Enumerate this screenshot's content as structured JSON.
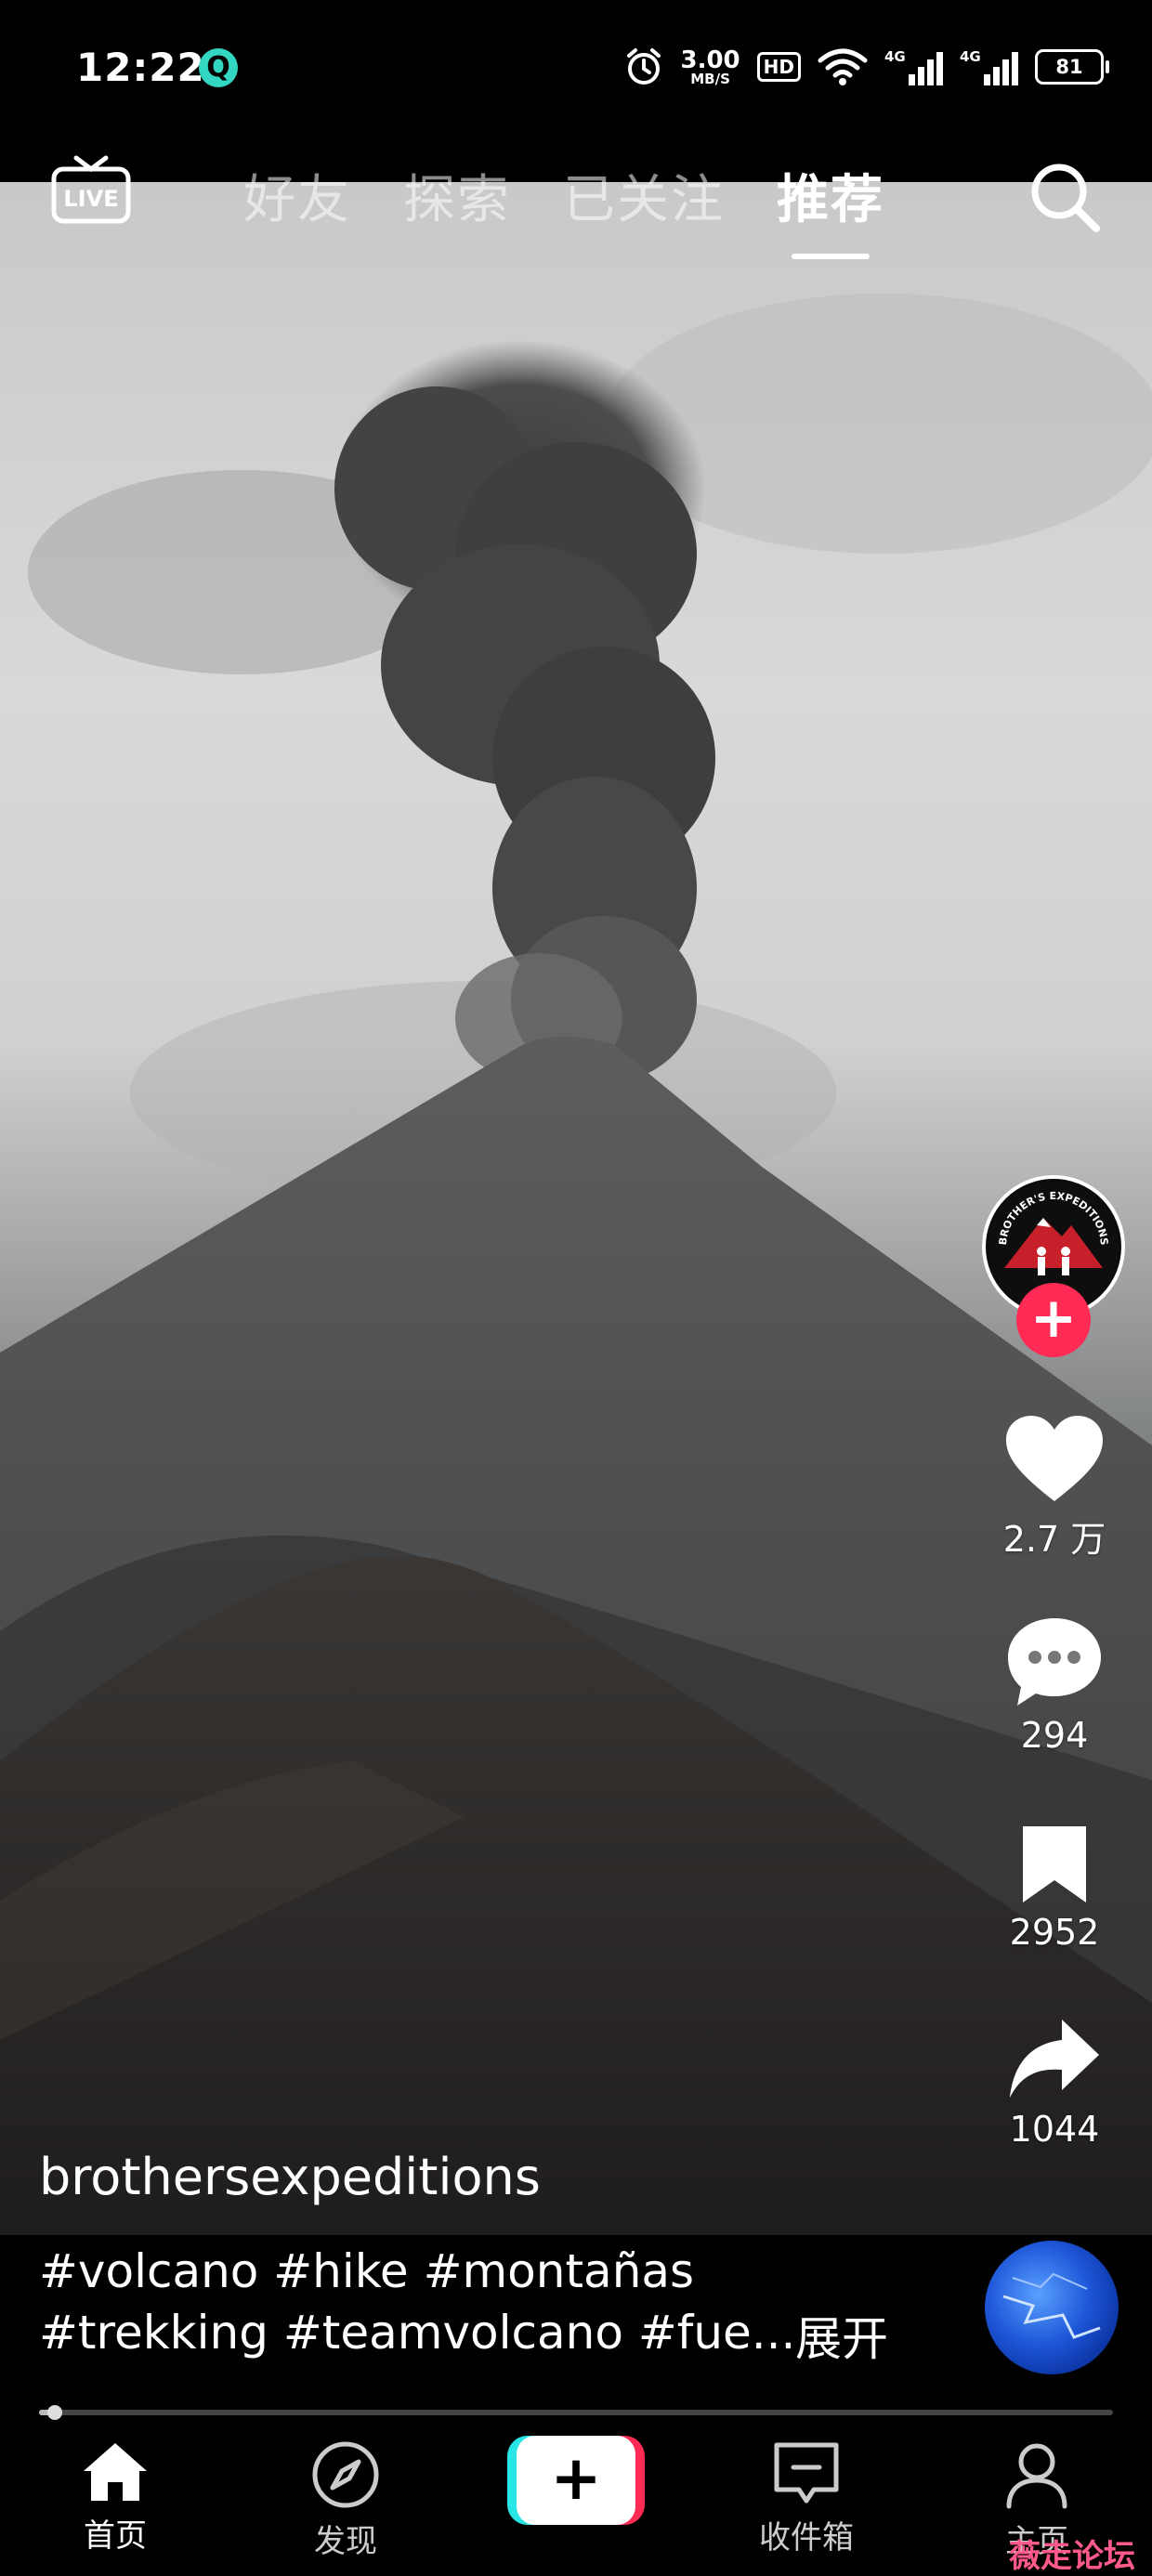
{
  "status_bar": {
    "time": "12:22",
    "app_icon_letter": "Q",
    "net_speed_value": "3.00",
    "net_speed_unit": "MB/S",
    "hd_label": "HD",
    "signal_1_label": "4G",
    "signal_2_label": "4G",
    "battery": "81"
  },
  "top_nav": {
    "live_label": "LIVE",
    "tabs": [
      {
        "label": "好友",
        "active": false
      },
      {
        "label": "探索",
        "active": false
      },
      {
        "label": "已关注",
        "active": false
      },
      {
        "label": "推荐",
        "active": true
      }
    ]
  },
  "video": {
    "author": "brothersexpeditions",
    "caption_line1": "#volcano #hike #montañas",
    "caption_line2": "#trekking #teamvolcano #fue...",
    "expand_label": "展开",
    "avatar_text": "BROTHER'S EXPEDITIONS",
    "progress_fraction": 0.015
  },
  "actions": {
    "likes": "2.7 万",
    "comments": "294",
    "favorites": "2952",
    "shares": "1044"
  },
  "bottom_nav": {
    "home": "首页",
    "discover": "发现",
    "inbox": "收件箱",
    "profile": "主页"
  },
  "watermark": "薇走论坛",
  "colors": {
    "accent_red": "#ff2b55",
    "accent_cyan": "#29e6e6"
  }
}
